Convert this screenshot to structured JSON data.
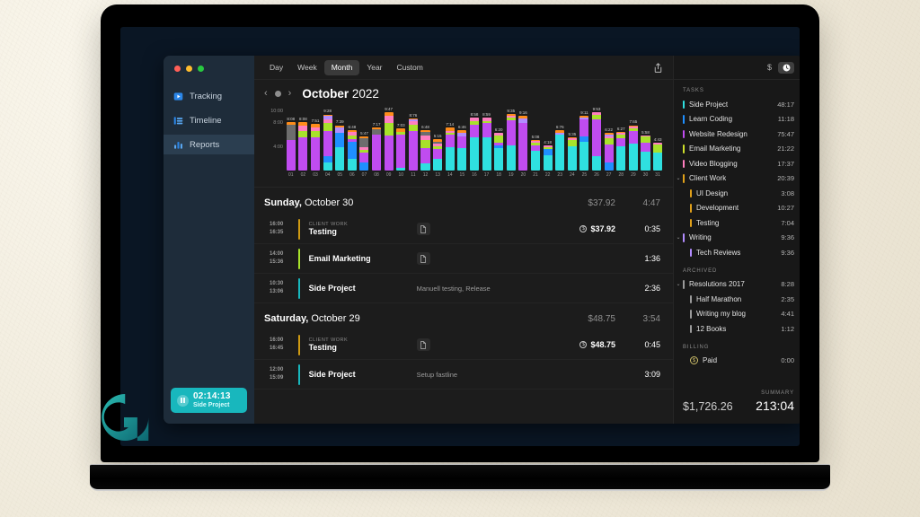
{
  "app": {
    "window_controls": [
      "close",
      "minimize",
      "maximize"
    ],
    "sidebar": {
      "items": [
        {
          "label": "Tracking",
          "icon": "tracking-icon",
          "active": false
        },
        {
          "label": "Timeline",
          "icon": "timeline-icon",
          "active": false
        },
        {
          "label": "Reports",
          "icon": "reports-icon",
          "active": true
        }
      ],
      "timer": {
        "time": "02:14:13",
        "project": "Side Project",
        "state": "running",
        "icon": "pause-icon"
      }
    },
    "toolbar": {
      "ranges": [
        {
          "label": "Day",
          "active": false
        },
        {
          "label": "Week",
          "active": false
        },
        {
          "label": "Month",
          "active": true
        },
        {
          "label": "Year",
          "active": false
        },
        {
          "label": "Custom",
          "active": false
        }
      ],
      "share_icon": "share-icon",
      "currency_toggle": "$",
      "clock_toggle_icon": "clock-icon"
    },
    "period": {
      "prev_icon": "chevron-left-icon",
      "today_icon": "today-dot-icon",
      "next_icon": "chevron-right-icon",
      "month": "October",
      "year": "2022"
    }
  },
  "chart_data": {
    "type": "bar",
    "title": "October 2022",
    "xlabel": "",
    "ylabel": "",
    "stacked": true,
    "grid": false,
    "legend": "none",
    "ylim": [
      0,
      10
    ],
    "yticks": [
      "10:00",
      "8:00",
      "4:00"
    ],
    "ytick_values": [
      10,
      8,
      4
    ],
    "categories": [
      "01",
      "02",
      "03",
      "04",
      "05",
      "06",
      "07",
      "08",
      "09",
      "10",
      "11",
      "12",
      "13",
      "14",
      "15",
      "16",
      "17",
      "18",
      "19",
      "20",
      "21",
      "22",
      "23",
      "24",
      "25",
      "26",
      "27",
      "28",
      "29",
      "30",
      "31"
    ],
    "data_labels": [
      "8:08",
      "8:08",
      "7:51",
      "9:28",
      "7:39",
      "6:48",
      "5:47",
      "7:17",
      "9:47",
      "7:03",
      "8:76",
      "6:48",
      "5:15",
      "7:14",
      "6:46",
      "8:58",
      "8:59",
      "6:20",
      "9:35",
      "9:16",
      "5:08",
      "4:18",
      "6:76",
      "5:35",
      "9:11",
      "9:53",
      "6:22",
      "6:27",
      "7:65",
      "5:58",
      "4:43"
    ],
    "totals": [
      8.13,
      8.13,
      7.85,
      9.47,
      7.65,
      6.8,
      5.78,
      7.28,
      9.78,
      7.05,
      8.76,
      6.8,
      5.25,
      7.23,
      6.76,
      8.96,
      8.98,
      6.33,
      9.58,
      9.26,
      5.13,
      4.3,
      6.76,
      5.58,
      9.18,
      9.88,
      6.36,
      6.45,
      7.65,
      5.96,
      4.71
    ],
    "series": [
      {
        "name": "Side Project",
        "color": "#2fe0e0",
        "values": [
          0,
          0,
          0,
          1.4,
          4.0,
          2.2,
          0,
          0,
          0,
          0.5,
          0,
          1.2,
          2.0,
          4.0,
          3.8,
          5.6,
          5.6,
          4.4,
          4.2,
          0,
          3.4,
          2.6,
          6.0,
          4.1,
          4.9,
          2.5,
          0,
          4.1,
          4.6,
          3.2,
          3.1
        ]
      },
      {
        "name": "Learn Coding",
        "color": "#1f8fff",
        "values": [
          0,
          0,
          0,
          1.0,
          2.4,
          3.1,
          1.4,
          0,
          0,
          0,
          0,
          0,
          0,
          0,
          0,
          0,
          0,
          0.5,
          0,
          0,
          0,
          1.0,
          0,
          0,
          0.8,
          0,
          1.3,
          0,
          0,
          0,
          0
        ]
      },
      {
        "name": "Website Redesign",
        "color": "#c04cf0",
        "values": [
          5.2,
          5.6,
          5.6,
          4.2,
          0,
          0.5,
          1.6,
          6.1,
          5.9,
          5.6,
          6.6,
          2.6,
          1.6,
          2.0,
          2.0,
          2.2,
          2.4,
          0.6,
          4.3,
          8.0,
          0.8,
          0,
          0,
          0,
          3.0,
          6.1,
          3.1,
          1.4,
          2.0,
          1.5,
          0
        ]
      },
      {
        "name": "Email Marketing",
        "color": "#a8e22b",
        "values": [
          0,
          1.1,
          1.0,
          1.5,
          0,
          0.7,
          0.5,
          0,
          2.1,
          0.4,
          1.1,
          1.4,
          0.5,
          0.4,
          0,
          0.5,
          0.4,
          1.4,
          0.5,
          0,
          0.5,
          0.4,
          0,
          1.0,
          0,
          0.8,
          1.0,
          0.6,
          0.5,
          1.0,
          1.3
        ]
      },
      {
        "name": "Video Blogging",
        "color": "#ff7ec0",
        "values": [
          0,
          0.9,
          0.6,
          0.5,
          0,
          0.6,
          0.5,
          0,
          1.2,
          0,
          0.6,
          0.7,
          0.4,
          0.2,
          0,
          0.6,
          0.5,
          0.4,
          0.3,
          0,
          0.3,
          0.3,
          0,
          0.3,
          0,
          0.4,
          0.4,
          0.3,
          0.3,
          0.2,
          0.3
        ]
      },
      {
        "name": "Client Work",
        "color": "#6d6d6d",
        "values": [
          2.5,
          0,
          0,
          0,
          0,
          0,
          1.5,
          0.8,
          0,
          0,
          0,
          0.6,
          0.4,
          0,
          0,
          0,
          0,
          0,
          0,
          0,
          0,
          0,
          0,
          0,
          0,
          0,
          0,
          0,
          0,
          0,
          0
        ]
      },
      {
        "name": "Writing",
        "color": "#b28cff",
        "values": [
          0,
          0,
          0,
          0.6,
          0.9,
          0,
          0,
          0,
          0,
          0,
          0.3,
          0,
          0,
          0,
          0.6,
          0,
          0,
          0,
          0,
          0.8,
          0,
          0,
          0.4,
          0,
          0.3,
          0,
          0.2,
          0,
          0,
          0,
          0
        ]
      },
      {
        "name": "Resolutions",
        "color": "#ff8c1a",
        "values": [
          0.43,
          0.53,
          0.65,
          0.27,
          0.35,
          0.32,
          0.28,
          0.38,
          0.58,
          0.55,
          0.16,
          0.3,
          0.35,
          0.63,
          0.36,
          0.06,
          0.08,
          0.03,
          0.28,
          0.46,
          0.13,
          0.0,
          0.36,
          0.18,
          0.18,
          0.08,
          0.36,
          0.05,
          0.25,
          0.06,
          0.01
        ]
      }
    ]
  },
  "entries": {
    "days": [
      {
        "dow": "Sunday,",
        "date": "October 30",
        "amount": "$37.92",
        "duration": "4:47",
        "rows": [
          {
            "start": "16:00",
            "end": "16:35",
            "color": "#cf9a12",
            "project": "CLIENT WORK",
            "task": "Testing",
            "note": "",
            "has_doc": true,
            "doc_icon": "document-icon",
            "billed": true,
            "money": "$37.92",
            "duration": "0:35"
          },
          {
            "start": "14:00",
            "end": "15:36",
            "color": "#a8e22b",
            "project": "",
            "task": "Email Marketing",
            "note": "",
            "has_doc": true,
            "doc_icon": "document-icon",
            "billed": false,
            "money": "",
            "duration": "1:36"
          },
          {
            "start": "10:30",
            "end": "13:06",
            "color": "#18b7bd",
            "project": "",
            "task": "Side Project",
            "note": "Manuell testing, Release",
            "has_doc": false,
            "doc_icon": "",
            "billed": false,
            "money": "",
            "duration": "2:36"
          }
        ]
      },
      {
        "dow": "Saturday,",
        "date": "October 29",
        "amount": "$48.75",
        "duration": "3:54",
        "rows": [
          {
            "start": "16:00",
            "end": "16:45",
            "color": "#cf9a12",
            "project": "CLIENT WORK",
            "task": "Testing",
            "note": "",
            "has_doc": true,
            "doc_icon": "document-icon",
            "billed": true,
            "money": "$48.75",
            "duration": "0:45"
          },
          {
            "start": "12:00",
            "end": "15:09",
            "color": "#18b7bd",
            "project": "",
            "task": "Side Project",
            "note": "Setup fastline",
            "has_doc": false,
            "doc_icon": "",
            "billed": false,
            "money": "",
            "duration": "3:09"
          }
        ]
      }
    ]
  },
  "right_panel": {
    "tasks_header": "TASKS",
    "tasks": [
      {
        "name": "Side Project",
        "time": "48:17",
        "color": "#2fe0e0",
        "child": false,
        "expandable": false
      },
      {
        "name": "Learn Coding",
        "time": "11:18",
        "color": "#1f8fff",
        "child": false,
        "expandable": false
      },
      {
        "name": "Website Redesign",
        "time": "75:47",
        "color": "#c04cf0",
        "child": false,
        "expandable": false
      },
      {
        "name": "Email Marketing",
        "time": "21:22",
        "color": "#cfe02b",
        "child": false,
        "expandable": false
      },
      {
        "name": "Video Blogging",
        "time": "17:37",
        "color": "#ff7ec0",
        "child": false,
        "expandable": false
      },
      {
        "name": "Client Work",
        "time": "20:39",
        "color": "#e0a01a",
        "child": false,
        "expandable": true
      },
      {
        "name": "UI Design",
        "time": "3:08",
        "color": "#e0a01a",
        "child": true,
        "expandable": false
      },
      {
        "name": "Development",
        "time": "10:27",
        "color": "#e0a01a",
        "child": true,
        "expandable": false
      },
      {
        "name": "Testing",
        "time": "7:04",
        "color": "#e0a01a",
        "child": true,
        "expandable": false
      },
      {
        "name": "Writing",
        "time": "9:36",
        "color": "#b28cff",
        "child": false,
        "expandable": true
      },
      {
        "name": "Tech Reviews",
        "time": "9:36",
        "color": "#b28cff",
        "child": true,
        "expandable": false
      }
    ],
    "archived_header": "ARCHIVED",
    "archived": [
      {
        "name": "Resolutions 2017",
        "time": "8:28",
        "color": "#9a9a9a",
        "child": false,
        "expandable": true
      },
      {
        "name": "Half Marathon",
        "time": "2:35",
        "color": "#9a9a9a",
        "child": true,
        "expandable": false
      },
      {
        "name": "Writing my blog",
        "time": "4:41",
        "color": "#9a9a9a",
        "child": true,
        "expandable": false
      },
      {
        "name": "12 Books",
        "time": "1:12",
        "color": "#9a9a9a",
        "child": true,
        "expandable": false
      }
    ],
    "billing_header": "BILLING",
    "billing": [
      {
        "name": "Paid",
        "time": "0:00",
        "icon": "coin-icon"
      }
    ],
    "summary_label": "SUMMARY",
    "summary_money": "$1,726.26",
    "summary_time": "213:04"
  },
  "branding": {
    "logo_letter": "G",
    "logo_color": "#1f9a9a"
  }
}
